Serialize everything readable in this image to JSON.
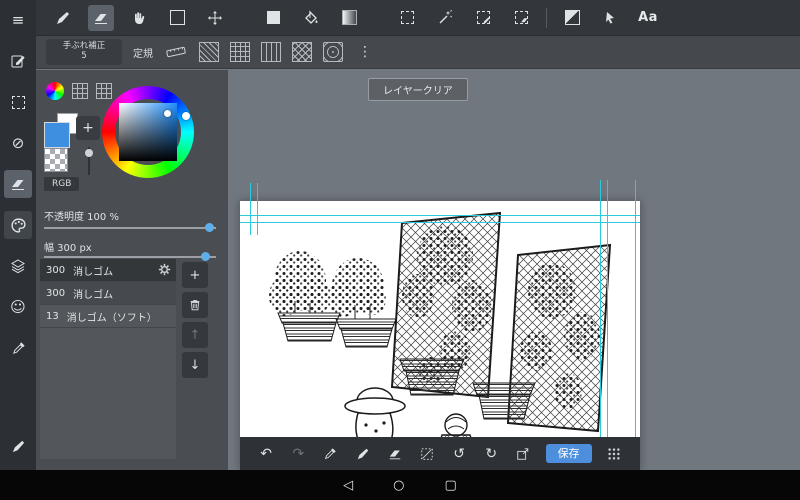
{
  "app": {
    "name_hint": "paint-app"
  },
  "colors": {
    "accent_blue": "#4d8fdc",
    "foreground_color": "#3e8fe0",
    "guide_cyan": "#2bc9d9",
    "toolbar_bg": "#33373b",
    "panel_bg": "#4a4e53",
    "canvas_bg": "#ffffff"
  },
  "glyphs": {
    "menu": "≡",
    "slash": "⊘",
    "smiley": "☺",
    "overflow": "⋮",
    "plus": "+",
    "undo": "↶",
    "redo": "↷",
    "rotate_ccw": "↺",
    "rotate_cw": "↻",
    "arrow_up": "↑",
    "arrow_down": "↓",
    "back": "◁",
    "home": "○",
    "recent": "▢"
  },
  "top_toolbar": {
    "tools": [
      "pen",
      "eraser",
      "hand",
      "shape",
      "move",
      "fill-rect",
      "bucket",
      "gradient",
      "select",
      "magic-wand",
      "select-pen",
      "select-eraser",
      "tone",
      "operation",
      "text"
    ],
    "selected_tool": "eraser",
    "text_tool_label": "Aa"
  },
  "second_toolbar": {
    "stabilizer_label": "手ぶれ補正",
    "stabilizer_value": "5",
    "ruler_label": "定規",
    "ruler_modes": [
      "ruler",
      "parallel-lines",
      "grid",
      "vertical-lines",
      "crosshatch",
      "concentric"
    ]
  },
  "sidebar": {
    "items": [
      "menu",
      "edit",
      "select",
      "material",
      "eraser",
      "palette",
      "layers",
      "face",
      "eyedropper",
      "brush"
    ],
    "active_item": "eraser"
  },
  "left_panel": {
    "rgb_label": "RGB",
    "opacity_label": "不透明度 100 %",
    "width_label": "幅 300 px",
    "brush_list": [
      {
        "size": "300",
        "name": "消しゴム",
        "selected": true
      },
      {
        "size": "300",
        "name": "消しゴム",
        "selected": false
      },
      {
        "size": "13",
        "name": "消しゴム（ソフト）",
        "selected": false
      }
    ]
  },
  "canvas": {
    "toast_label": "レイヤークリア"
  },
  "bottom_toolbar": {
    "icons": [
      "undo",
      "redo",
      "eyedropper",
      "pen",
      "eraser",
      "deselect",
      "rotate-ccw",
      "rotate-cw",
      "export",
      "save",
      "gallery-grid"
    ],
    "save_label": "保存"
  },
  "nav_bar": {
    "items": [
      "back",
      "home",
      "recent"
    ]
  }
}
